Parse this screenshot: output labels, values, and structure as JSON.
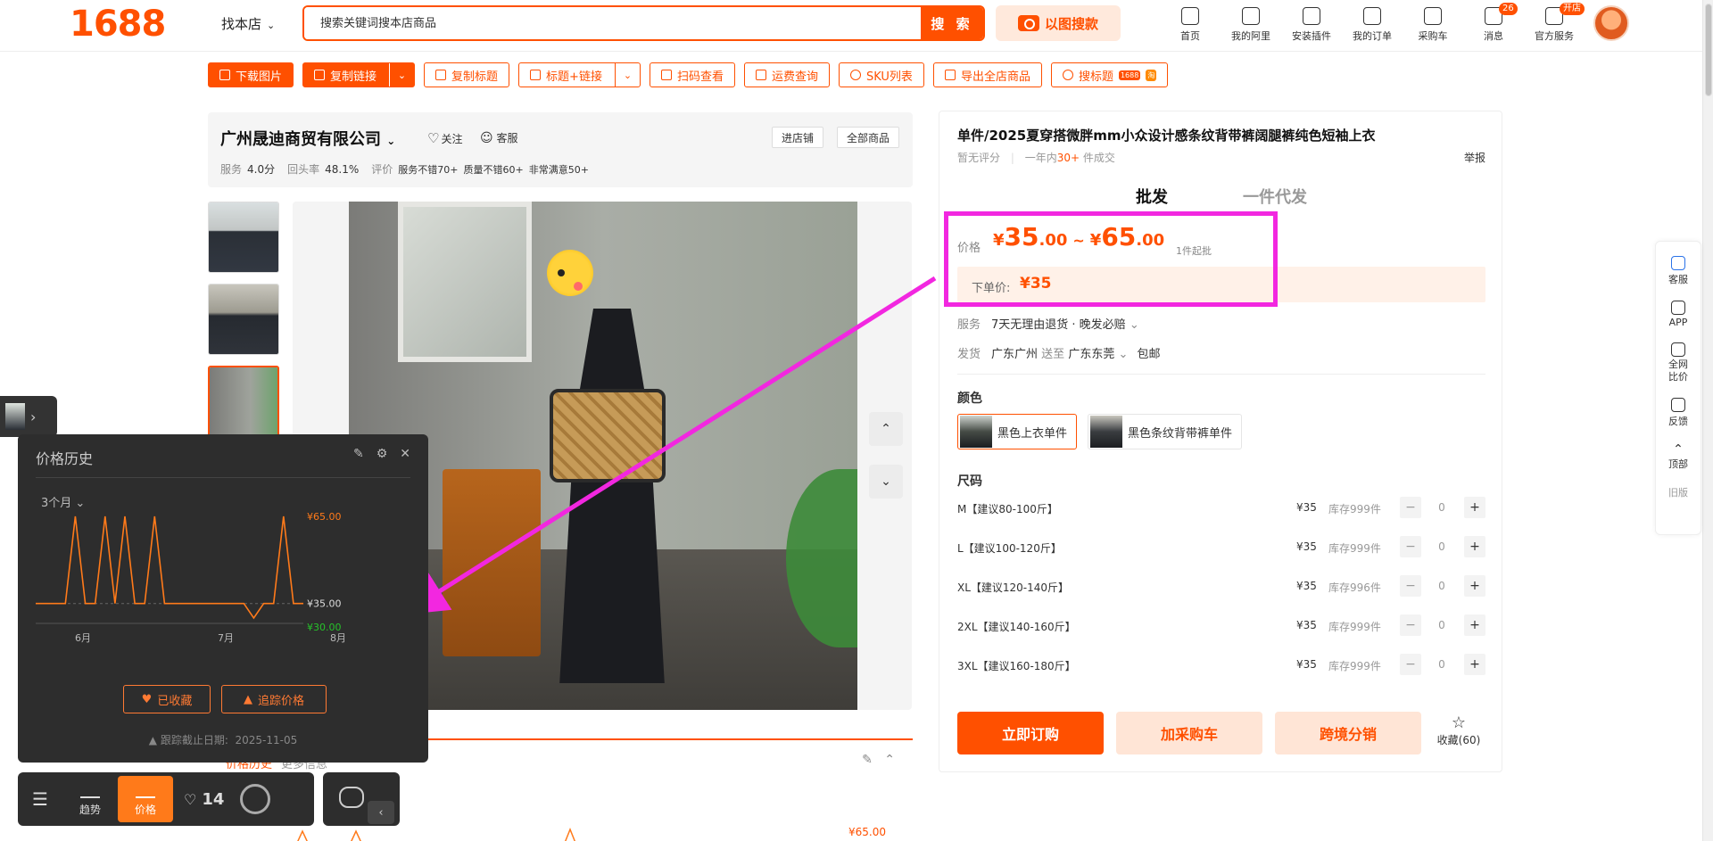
{
  "header": {
    "logo": "1688",
    "store_selector": "找本店",
    "search_placeholder": "搜索关键词搜本店商品",
    "search_button": "搜 索",
    "image_search": "以图搜款",
    "nav": [
      {
        "label": "首页",
        "icon": "home-icon",
        "badge": ""
      },
      {
        "label": "我的阿里",
        "icon": "heart-shield-icon",
        "badge": ""
      },
      {
        "label": "安装插件",
        "icon": "puzzle-icon",
        "badge": ""
      },
      {
        "label": "我的订单",
        "icon": "clipboard-icon",
        "badge": ""
      },
      {
        "label": "采购车",
        "icon": "cart-icon",
        "badge": ""
      },
      {
        "label": "消息",
        "icon": "message-icon",
        "badge": "26"
      },
      {
        "label": "官方服务",
        "icon": "user-icon",
        "badge": "开店"
      }
    ]
  },
  "toolbar": {
    "download_images": "下载图片",
    "copy_link": "复制链接",
    "copy_title": "复制标题",
    "title_link": "标题+链接",
    "scan_view": "扫码查看",
    "shipping_query": "运费查询",
    "sku_list": "SKU列表",
    "export_all": "导出全店商品",
    "search_title": "搜标题",
    "search_title_badge": "1688"
  },
  "company": {
    "name": "广州晟迪商贸有限公司",
    "follow": "关注",
    "service": "客服",
    "service_label": "服务",
    "service_score": "4.0分",
    "repeat_label": "回头率",
    "repeat_rate": "48.1%",
    "review_label": "评价",
    "tags": [
      "服务不错70+",
      "质量不错60+",
      "非常满意50+"
    ],
    "enter_shop": "进店铺",
    "all_products": "全部商品"
  },
  "product": {
    "title": "单件/2025夏穿搭微胖mm小众设计感条纹背带裤阔腿裤纯色短袖上衣",
    "rating": "暂无评分",
    "sales_prefix": "一年内",
    "sales_num": "30+",
    "sales_suffix": "件成交",
    "report": "举报",
    "tabs": [
      "批发",
      "一件代发"
    ],
    "price_label": "价格",
    "price_low_int": "35",
    "price_low_dec": ".00",
    "price_high_int": "65",
    "price_high_dec": ".00",
    "currency": "¥",
    "min_order": "1件起批",
    "order_price_label": "下单价:",
    "order_price": "¥35",
    "service_label": "服务",
    "service_value": "7天无理由退货 · 晚发必赔",
    "ship_label": "发货",
    "ship_from": "广东广州",
    "ship_to_word": "送至",
    "ship_to": "广东东莞",
    "ship_free": "包邮",
    "color_label": "颜色",
    "colors": [
      "黑色上衣单件",
      "黑色条纹背带裤单件"
    ],
    "size_label": "尺码",
    "sizes": [
      {
        "name": "M【建议80-100斤】",
        "price": "¥35",
        "stock": "库存999件",
        "qty": "0"
      },
      {
        "name": "L【建议100-120斤】",
        "price": "¥35",
        "stock": "库存999件",
        "qty": "0"
      },
      {
        "name": "XL【建议120-140斤】",
        "price": "¥35",
        "stock": "库存996件",
        "qty": "0"
      },
      {
        "name": "2XL【建议140-160斤】",
        "price": "¥35",
        "stock": "库存999件",
        "qty": "0"
      },
      {
        "name": "3XL【建议160-180斤】",
        "price": "¥35",
        "stock": "库存999件",
        "qty": "0"
      }
    ],
    "buy_now": "立即订购",
    "add_cart": "加采购车",
    "cross_border": "跨境分销",
    "favorite": "收藏(60)"
  },
  "floatbar": {
    "items": [
      "客服",
      "APP",
      "全网比价",
      "反馈",
      "顶部",
      "旧版"
    ]
  },
  "price_history": {
    "title": "价格历史",
    "range": "3个月",
    "collected": "已收藏",
    "track": "追踪价格",
    "footer_label": "跟踪截止日期:",
    "footer_date": "2025-11-05",
    "dock": {
      "trend": "趋势",
      "price": "价格",
      "fav_count": "14"
    }
  },
  "lower_panel": {
    "tab_active": "价格历史",
    "tab_other": "更多信息",
    "top_price": "¥65.00"
  },
  "chart_data": {
    "type": "line",
    "x_ticks": [
      "6月",
      "7月",
      "8月"
    ],
    "y_labels": [
      "¥65.00",
      "¥35.00",
      "¥30.00"
    ],
    "ylim": [
      30,
      65
    ],
    "series": [
      {
        "values": [
          35,
          35,
          35,
          35,
          65,
          35,
          35,
          65,
          35,
          65,
          35,
          35,
          65,
          35,
          35,
          35,
          35,
          35,
          35,
          35,
          35,
          35,
          30,
          35,
          35,
          65,
          35,
          35
        ],
        "color": "#ff7a1a"
      }
    ]
  },
  "colors": {
    "accent": "#ff5000",
    "highlight": "#f227e0",
    "low_price": "#26c22a"
  }
}
